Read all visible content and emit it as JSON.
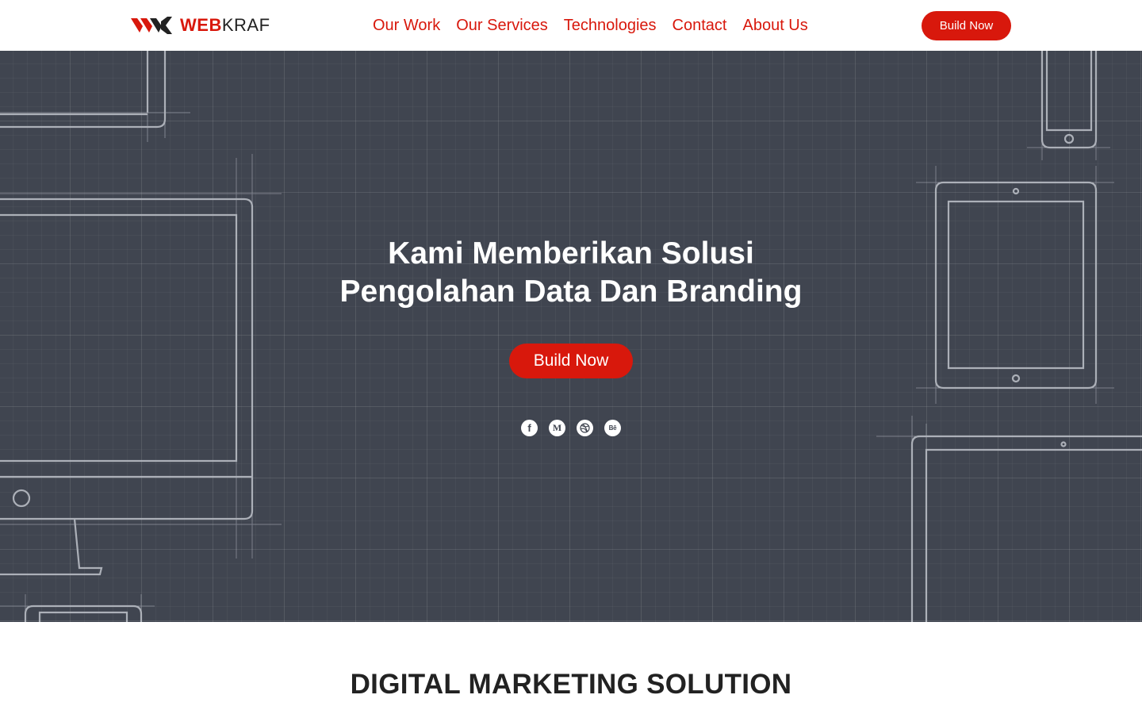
{
  "brand": {
    "logo_part1": "WEB",
    "logo_part2": "KRAF",
    "accent_color": "#d8180c",
    "dark_color": "#222222"
  },
  "nav": {
    "items": [
      "Our Work",
      "Our Services",
      "Technologies",
      "Contact",
      "About Us"
    ]
  },
  "header": {
    "cta_label": "Build Now"
  },
  "hero": {
    "title_line1": "Kami Memberikan Solusi",
    "title_line2": "Pengolahan Data Dan Branding",
    "cta_label": "Build Now",
    "background_color": "#404550",
    "socials": [
      {
        "icon": "facebook-icon",
        "glyph": "f"
      },
      {
        "icon": "medium-icon",
        "glyph": "M"
      },
      {
        "icon": "dribbble-icon",
        "glyph": "dribbble"
      },
      {
        "icon": "behance-icon",
        "glyph": "Bē"
      }
    ]
  },
  "section": {
    "title": "DIGITAL MARKETING SOLUTION"
  }
}
